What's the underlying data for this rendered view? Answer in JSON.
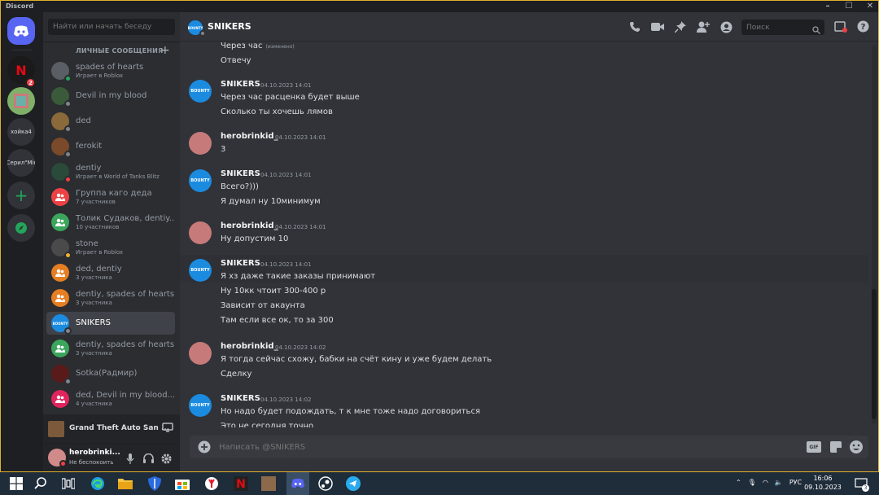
{
  "window": {
    "title": "Discord"
  },
  "guilds": [
    {
      "label": "хойка4",
      "badge": ""
    },
    {
      "label": "Серил\"Mir",
      "badge": ""
    }
  ],
  "guild_badge": "2",
  "sidebar": {
    "search_placeholder": "Найти или начать беседу",
    "dm_header": "ЛИЧНЫЕ СООБЩЕНИЯ",
    "dms": [
      {
        "name": "spades of hearts",
        "sub": "Играет в Roblox",
        "color": "#5a5f66",
        "status": "#23a55a"
      },
      {
        "name": "Devil in my blood",
        "sub": "",
        "color": "#3a5a3a",
        "status": "#80848e"
      },
      {
        "name": "ded",
        "sub": "",
        "color": "#8a6a3a",
        "status": "#80848e"
      },
      {
        "name": "ferokit",
        "sub": "",
        "color": "#7a4a2a",
        "status": "#80848e"
      },
      {
        "name": "dentiy",
        "sub": "Играет в World of Tanks Blitz",
        "color": "#2a4a3a",
        "status": "#f23f43"
      },
      {
        "name": "Группа каго деда",
        "sub": "7 участников",
        "color": "#ed4245",
        "status": ""
      },
      {
        "name": "Толик Судаков, dentiy...",
        "sub": "10 участников",
        "color": "#3ba55c",
        "status": ""
      },
      {
        "name": "stone",
        "sub": "Играет в Roblox",
        "color": "#4a4a4a",
        "status": "#f0b232"
      },
      {
        "name": "ded, dentiy",
        "sub": "3 участника",
        "color": "#e67e22",
        "status": ""
      },
      {
        "name": "dentiy, spades of hearts",
        "sub": "3 участника",
        "color": "#e67e22",
        "status": ""
      },
      {
        "name": "SNIKERS",
        "sub": "",
        "color": "#1b8be0",
        "status": "#80848e"
      },
      {
        "name": "dentiy, spades of hearts",
        "sub": "3 участника",
        "color": "#3ba55c",
        "status": ""
      },
      {
        "name": "Sotka(Радмир)",
        "sub": "",
        "color": "#5a1a1a",
        "status": "#80848e"
      },
      {
        "name": "ded, Devil in my blood...",
        "sub": "4 участника",
        "color": "#e0245e",
        "status": ""
      }
    ]
  },
  "game": {
    "name": "Grand Theft Auto San ..."
  },
  "user": {
    "name": "herobrinki...",
    "status": "Не беспокоить"
  },
  "chat": {
    "channel_name": "SNIKERS",
    "avatar_text": "BOUNTY",
    "search_placeholder": "Поиск",
    "composer_placeholder": "Написать @SNIKERS",
    "gif_label": "GIF"
  },
  "messages": [
    {
      "author": "",
      "time": "",
      "lines": [
        {
          "text": "Через час",
          "edited": "(изменено)"
        },
        {
          "text": "Отвечу"
        }
      ]
    },
    {
      "author": "SNIKERS",
      "time": "04.10.2023 14:01",
      "lines": [
        {
          "text": "Через час расценка будет выше"
        },
        {
          "text": "Сколько ты хочешь лямов"
        }
      ]
    },
    {
      "author": "herobrinkid_",
      "time": "04.10.2023 14:01",
      "lines": [
        {
          "text": "3"
        }
      ]
    },
    {
      "author": "SNIKERS",
      "time": "04.10.2023 14:01",
      "lines": [
        {
          "text": "Всего?)))"
        },
        {
          "text": "Я думал ну 10минимум"
        }
      ]
    },
    {
      "author": "herobrinkid_",
      "time": "04.10.2023 14:01",
      "lines": [
        {
          "text": "Ну допустим 10"
        }
      ]
    },
    {
      "author": "SNIKERS",
      "time": "04.10.2023 14:01",
      "lines": [
        {
          "text": "Я хз даже такие заказы принимают"
        },
        {
          "text": "Ну 10кк чтоит 300-400 р"
        },
        {
          "text": "Зависит от акаунта"
        },
        {
          "text": "Там если все ок, то за 300"
        }
      ]
    },
    {
      "author": "herobrinkid_",
      "time": "04.10.2023 14:02",
      "lines": [
        {
          "text": "Я тогда сейчас схожу, бабки на счёт кину и уже будем делать"
        },
        {
          "text": "Сделку"
        }
      ]
    },
    {
      "author": "SNIKERS",
      "time": "04.10.2023 14:02",
      "lines": [
        {
          "text": "Но надо будет подождать, т к мне тоже надо договориться"
        },
        {
          "text": "Это не сегодня точно"
        }
      ]
    }
  ],
  "taskbar": {
    "lang": "РУС",
    "time": "16:06",
    "date": "09.10.2023",
    "notif": "3"
  }
}
